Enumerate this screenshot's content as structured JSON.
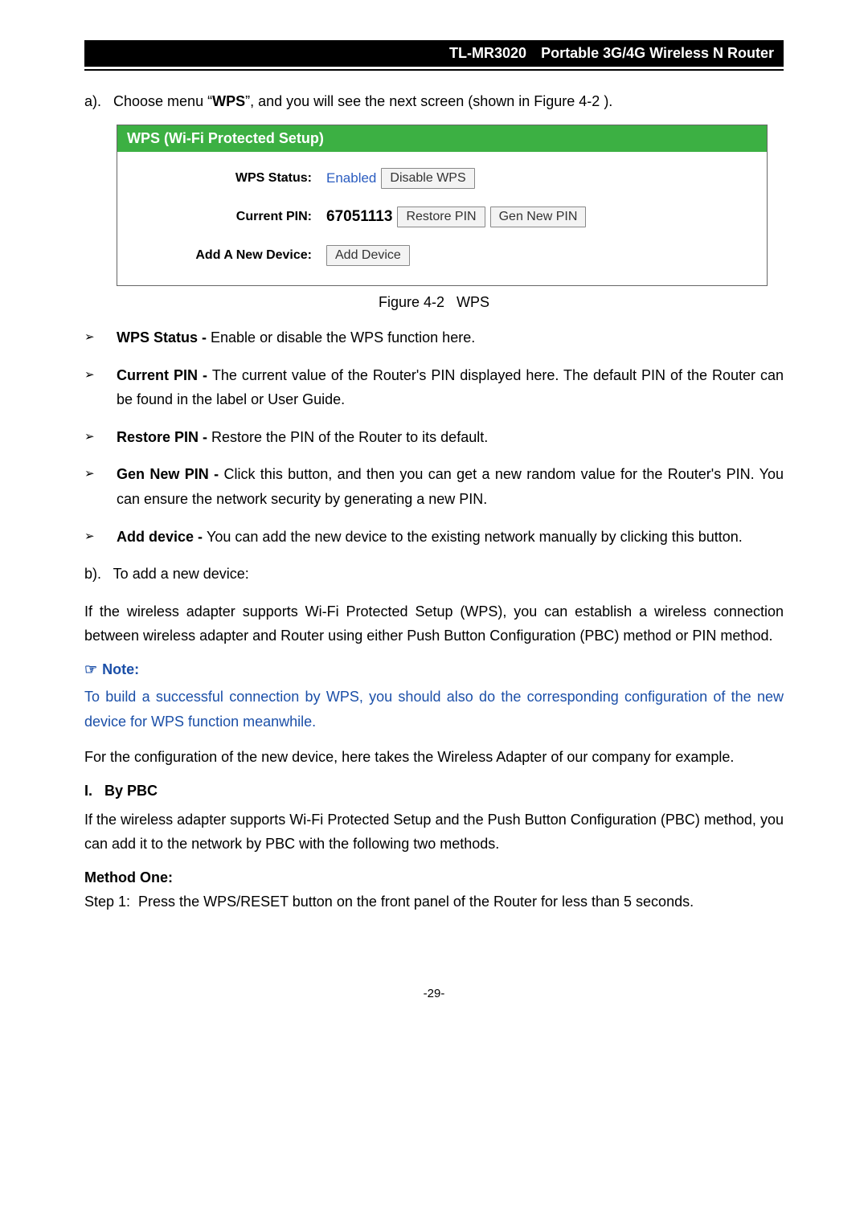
{
  "header": {
    "model": "TL-MR3020",
    "product": "Portable 3G/4G Wireless N Router"
  },
  "section_a": {
    "prefix": "a).   Choose menu “",
    "menu": "WPS",
    "suffix": "”, and you will see the next screen (shown in Figure 4-2 )."
  },
  "figure": {
    "title": "WPS (Wi-Fi Protected Setup)",
    "rows": {
      "status_label": "WPS Status:",
      "status_value": "Enabled",
      "disable_btn": "Disable WPS",
      "pin_label": "Current PIN:",
      "pin_value": "67051113",
      "restore_btn": "Restore PIN",
      "gen_btn": "Gen New PIN",
      "add_label": "Add A New Device:",
      "add_btn": "Add Device"
    },
    "caption": "Figure 4-2   WPS"
  },
  "bullets": [
    {
      "term": "WPS Status - ",
      "desc": "Enable or disable the WPS function here."
    },
    {
      "term": "Current PIN - ",
      "desc": "The current value of the Router's PIN displayed here. The default PIN of the Router can be found in the label or User Guide."
    },
    {
      "term": "Restore PIN - ",
      "desc": "Restore the PIN of the Router to its default."
    },
    {
      "term": "Gen New PIN - ",
      "desc": "Click this button, and then you can get a new random value for the Router's PIN. You can ensure the network security by generating a new PIN."
    },
    {
      "term": "Add device - ",
      "desc": "You can add the new device to the existing network manually by clicking this button."
    }
  ],
  "section_b": "b).   To add a new device:",
  "para_b": "If the wireless adapter supports Wi-Fi Protected Setup (WPS), you can establish a wireless connection between wireless adapter and Router using either Push Button Configuration (PBC) method or PIN method.",
  "note_heading": "Note:",
  "note_text": "To build a successful connection by WPS, you should also do the corresponding configuration of the new device for WPS function meanwhile.",
  "para_config": "For the configuration of the new device, here takes the Wireless Adapter of our company for example.",
  "by_pbc": "I.   By PBC",
  "para_pbc": "If the wireless adapter supports Wi-Fi Protected Setup and the Push Button Configuration (PBC) method, you can add it to the network by PBC with the following two methods.",
  "method_one": "Method One:",
  "step1": "Step 1:  Press the WPS/RESET button on the front panel of the Router for less than 5 seconds.",
  "page_number": "-29-"
}
